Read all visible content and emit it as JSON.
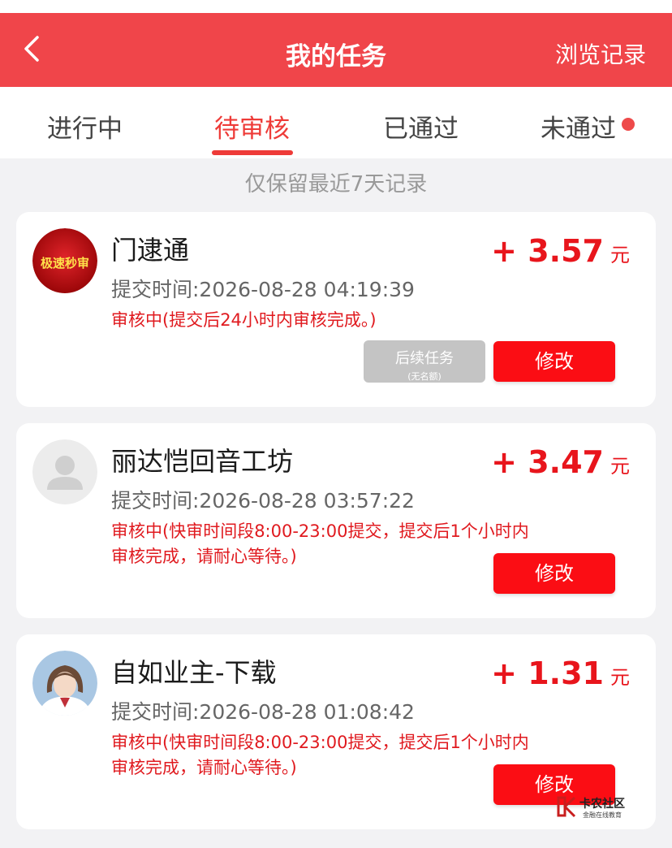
{
  "header": {
    "title": "我的任务",
    "history_label": "浏览记录"
  },
  "tabs": [
    {
      "label": "进行中"
    },
    {
      "label": "待审核"
    },
    {
      "label": "已通过"
    },
    {
      "label": "未通过"
    }
  ],
  "active_tab": "待审核",
  "notice": "仅保留最近7天记录",
  "tasks": [
    {
      "name": "门逮通",
      "avatar_label": "极速秒审",
      "amount": "+ 3.57",
      "unit": "元",
      "submit_time": "提交时间:2026-08-28 04:19:39",
      "status": "审核中(提交后24小时内审核完成。)",
      "follow_button": {
        "label": "后续任务",
        "sublabel": "(无名额)"
      },
      "edit_label": "修改"
    },
    {
      "name": "丽达恺回音工坊",
      "amount": "+ 3.47",
      "unit": "元",
      "submit_time": "提交时间:2026-08-28 03:57:22",
      "status": "审核中(快审时间段8:00-23:00提交，提交后1个小时内审核完成，请耐心等待。)",
      "edit_label": "修改"
    },
    {
      "name": "自如业主-下载",
      "amount": "+ 1.31",
      "unit": "元",
      "submit_time": "提交时间:2026-08-28 01:08:42",
      "status": "审核中(快审时间段8:00-23:00提交，提交后1个小时内审核完成，请耐心等待。)",
      "edit_label": "修改"
    }
  ],
  "watermark": {
    "title": "卡农社区",
    "subtitle": "金融在线教育"
  },
  "colors": {
    "header_bg": "#f0454a",
    "accent": "#ee3b38",
    "amount": "#e8151c",
    "button": "#fb0d14",
    "disabled_button": "#c4c4c4"
  }
}
